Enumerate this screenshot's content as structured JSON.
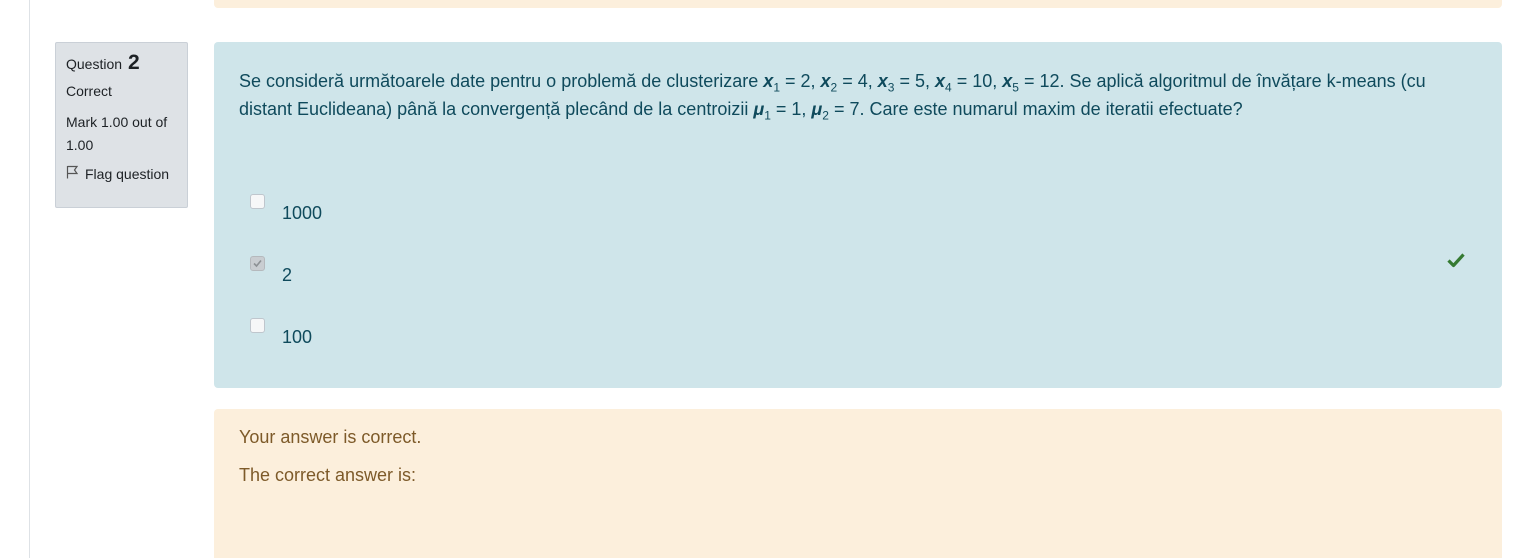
{
  "question": {
    "label": "Question",
    "number": "2",
    "state": "Correct",
    "grade": "Mark 1.00 out of 1.00",
    "flag_label": "Flag question"
  },
  "question_text": {
    "part1": "Se consideră următoarele date pentru o problemă de clusterizare ",
    "x1_val": " = 2, ",
    "x2_val": " = 4, ",
    "x3_val": " = 5, ",
    "x4_val": " = 10, ",
    "x5_val": " = 12. Se aplică algoritmul de învățare k-means (cu distant Euclideana) până la convergență plecând de la centroizii ",
    "mu1_val": " = 1, ",
    "mu2_val": " = 7. Care este numarul maxim de iteratii efectuate?",
    "var_x": "x",
    "var_mu": "μ",
    "sub1": "1",
    "sub2": "2",
    "sub3": "3",
    "sub4": "4",
    "sub5": "5"
  },
  "answers": [
    {
      "label": "1000",
      "checked": false,
      "correct_mark": false
    },
    {
      "label": "2",
      "checked": true,
      "correct_mark": true
    },
    {
      "label": "100",
      "checked": false,
      "correct_mark": false
    }
  ],
  "feedback": {
    "specific": "Your answer is correct.",
    "right_answer_label": "The correct answer is:"
  },
  "icons": {
    "flag": "flag-icon",
    "check": "check-icon"
  },
  "colors": {
    "content_bg": "#cfe5ea",
    "feedback_bg": "#fcefdc",
    "correct_green": "#357a32"
  }
}
